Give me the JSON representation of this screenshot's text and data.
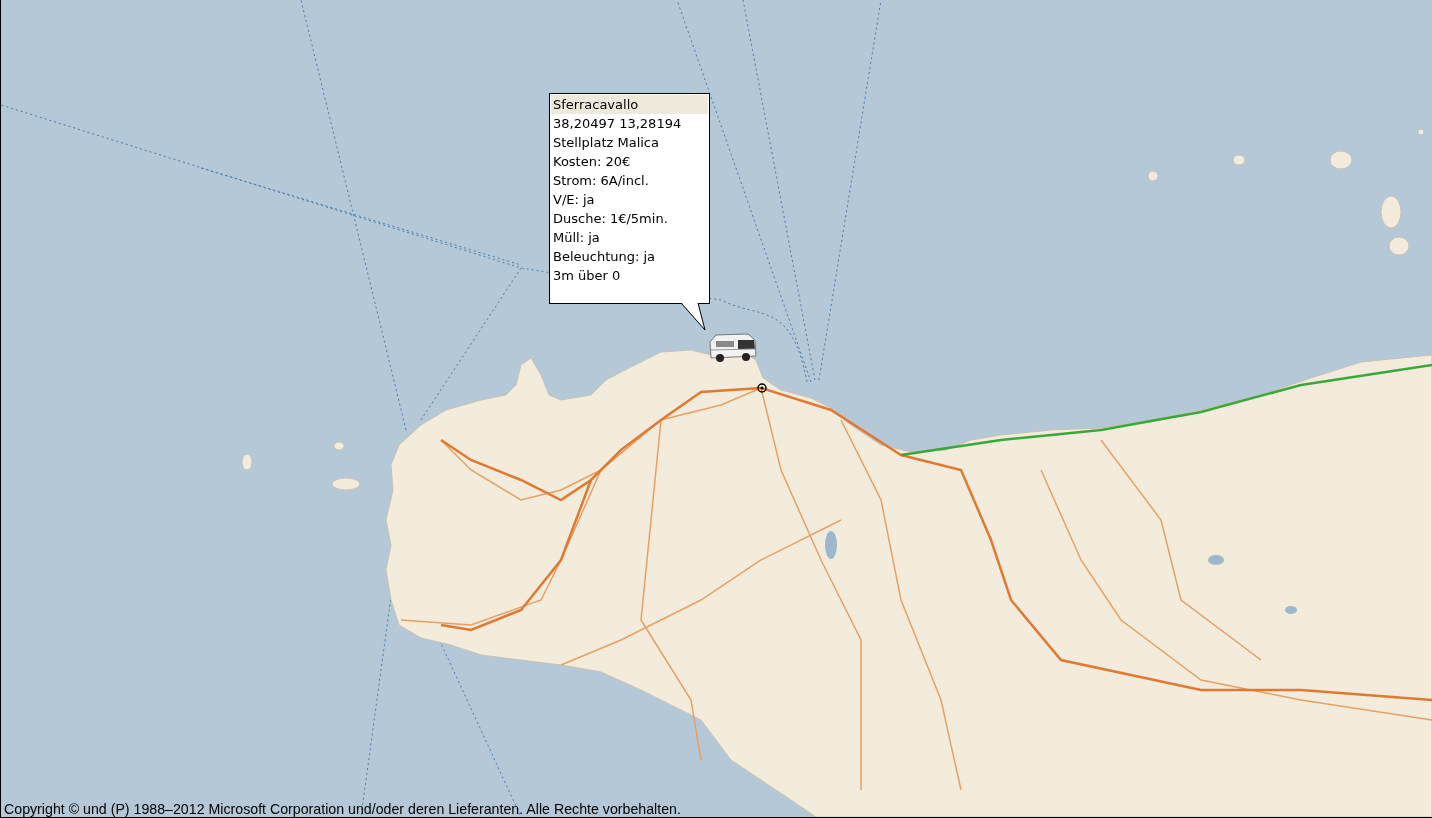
{
  "popup": {
    "title": "Sferracavallo",
    "lines": [
      "38,20497 13,28194",
      "Stellplatz Malica",
      "Kosten: 20€",
      "Strom: 6A/incl.",
      "V/E: ja",
      "Dusche: 1€/5min.",
      "Müll: ja",
      "Beleuchtung: ja",
      "3m über 0"
    ]
  },
  "copyright": "Copyright © und (P) 1988–2012 Microsoft Corporation und/oder deren Lieferanten. Alle Rechte vorbehalten."
}
